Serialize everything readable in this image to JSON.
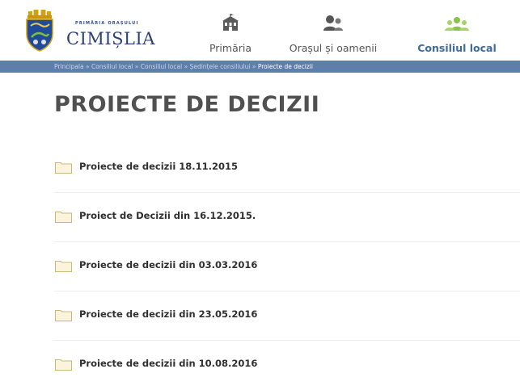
{
  "header": {
    "brand_small": "PRIMĂRIA ORAȘULUI",
    "brand_name": "CIMIȘLIA",
    "nav": [
      {
        "label": "Primăria",
        "icon": "building-icon"
      },
      {
        "label": "Orașul și oamenii",
        "icon": "people-icon"
      },
      {
        "label": "Consiliul local",
        "icon": "council-icon",
        "active": true
      }
    ]
  },
  "breadcrumb": {
    "items": [
      "Principala",
      "Consiliul local",
      "Consiliul local",
      "Ședințele consiliului"
    ],
    "separator": "»",
    "current": "Proiecte de decizii"
  },
  "page": {
    "title": "PROIECTE DE DECIZII"
  },
  "folders": [
    {
      "label": "Proiecte de decizii 18.11.2015"
    },
    {
      "label": "Proiect de Decizii din 16.12.2015."
    },
    {
      "label": "Proiecte de decizii din 03.03.2016"
    },
    {
      "label": "Proiecte de decizii din 23.05.2016"
    },
    {
      "label": "Proiecte de decizii din 10.08.2016"
    }
  ],
  "colors": {
    "brand": "#2c3f7d",
    "breadcrumb_bg": "#5e7fac",
    "active_nav": "#3d6b9b",
    "title": "#505050",
    "folder_fill": "#faf4dc",
    "folder_stroke": "#c9b978"
  }
}
